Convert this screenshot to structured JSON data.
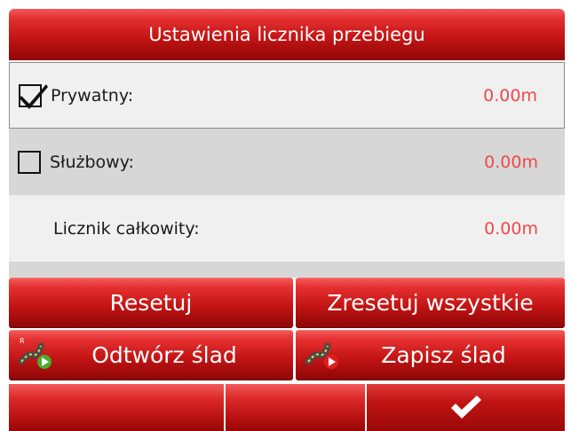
{
  "title": "Ustawienia licznika przebiegu",
  "rows": [
    {
      "label": "Prywatny:",
      "value": "0.00m",
      "checked": true
    },
    {
      "label": "Służbowy:",
      "value": "0.00m",
      "checked": false
    },
    {
      "label": "Licznik całkowity:",
      "value": "0.00m"
    }
  ],
  "buttons": {
    "reset": "Resetuj",
    "reset_all": "Zresetuj wszystkie",
    "replay_track": "Odtwórz ślad",
    "save_track": "Zapisz ślad"
  },
  "icons": {
    "replay": "track-replay-icon",
    "save": "track-record-icon",
    "ok": "checkmark-icon"
  },
  "colors": {
    "accent_red": "#c51515",
    "value_red": "#f04848"
  }
}
